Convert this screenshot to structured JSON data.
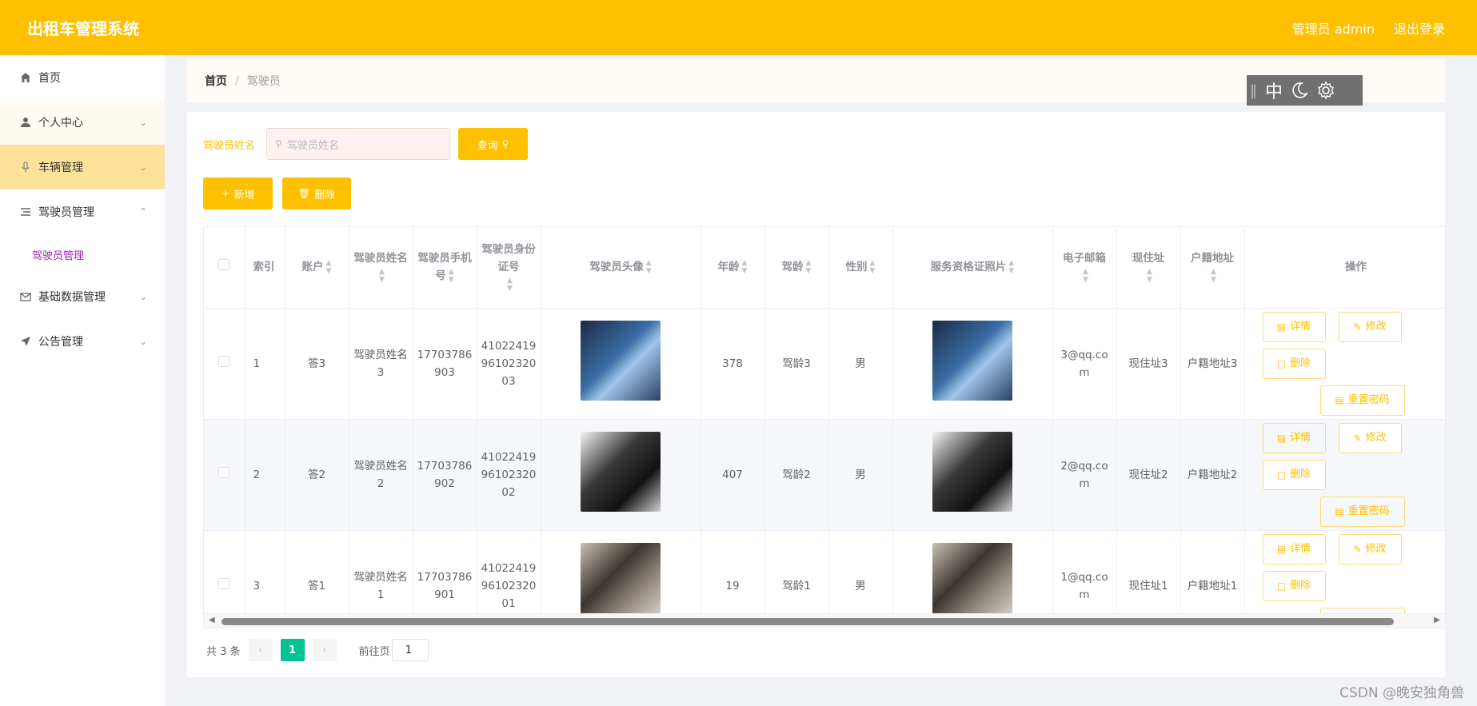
{
  "header": {
    "title": "出租车管理系统",
    "user": "管理员 admin",
    "logout": "退出登录"
  },
  "sidebar": {
    "items": [
      {
        "label": "首页",
        "icon": "home-icon"
      },
      {
        "label": "个人中心",
        "icon": "user-icon"
      },
      {
        "label": "车辆管理",
        "icon": "microphone-icon"
      },
      {
        "label": "驾驶员管理",
        "icon": "list-icon"
      },
      {
        "label": "基础数据管理",
        "icon": "mail-icon"
      },
      {
        "label": "公告管理",
        "icon": "send-icon"
      }
    ],
    "submenu": {
      "label": "驾驶员管理"
    }
  },
  "breadcrumb": {
    "home": "首页",
    "sep": "/",
    "current": "驾驶员"
  },
  "tools": {
    "lang": "中"
  },
  "search": {
    "label": "驾驶员姓名",
    "placeholder": "驾驶员姓名",
    "query_label": "查询"
  },
  "actions": {
    "add_label": "新增",
    "delete_label": "删除"
  },
  "table": {
    "headers": {
      "index": "索引",
      "account": "账户",
      "name": "驾驶员姓名",
      "phone": "驾驶员手机号",
      "idcard": "驾驶员身份证号",
      "avatar": "驾驶员头像",
      "age": "年龄",
      "driving_age": "驾龄",
      "gender": "性别",
      "cert_photo": "服务资格证照片",
      "email": "电子邮箱",
      "address": "现住址",
      "hukou": "户籍地址",
      "ops": "操作"
    },
    "rows": [
      {
        "index": "1",
        "account": "答3",
        "name": "驾驶员姓名3",
        "phone": "17703786903",
        "idcard": "410224199610232003",
        "age": "378",
        "driving_age": "驾龄3",
        "gender": "男",
        "email": "3@qq.com",
        "address": "现住址3",
        "hukou": "户籍地址3"
      },
      {
        "index": "2",
        "account": "答2",
        "name": "驾驶员姓名2",
        "phone": "17703786902",
        "idcard": "410224199610232002",
        "age": "407",
        "driving_age": "驾龄2",
        "gender": "男",
        "email": "2@qq.com",
        "address": "现住址2",
        "hukou": "户籍地址2"
      },
      {
        "index": "3",
        "account": "答1",
        "name": "驾驶员姓名1",
        "phone": "17703786901",
        "idcard": "410224199610232001",
        "age": "19",
        "driving_age": "驾龄1",
        "gender": "男",
        "email": "1@qq.com",
        "address": "现住址1",
        "hukou": "户籍地址1"
      }
    ],
    "ops": {
      "detail": "详情",
      "edit": "修改",
      "remove": "删除",
      "reset": "重置密码"
    }
  },
  "pager": {
    "total": "共 3 条",
    "current": "1",
    "goto_label": "前往页",
    "goto_value": "1"
  },
  "watermark": "CSDN @晚安独角兽",
  "colors": {
    "accent": "#ffc001",
    "page_active": "#00c292",
    "submenu": "#9c27b0"
  }
}
